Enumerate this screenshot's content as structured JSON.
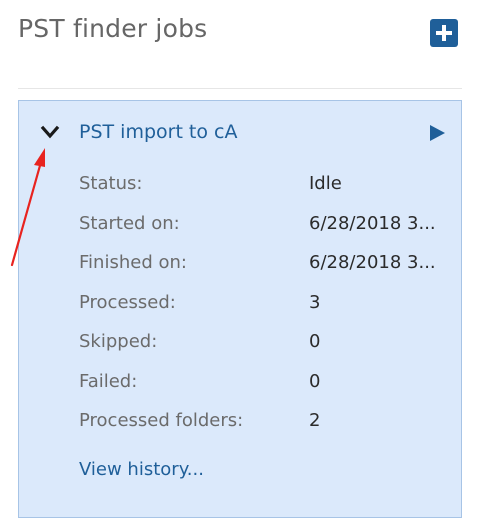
{
  "panel": {
    "title": "PST finder jobs",
    "add_icon": "plus-square-icon"
  },
  "job": {
    "title": "PST import to cA",
    "expand_icon": "chevron-down-icon",
    "run_icon": "play-icon",
    "details": [
      {
        "label": "Status:",
        "value": "Idle"
      },
      {
        "label": "Started on:",
        "value": "6/28/2018 3..."
      },
      {
        "label": "Finished on:",
        "value": "6/28/2018 3..."
      },
      {
        "label": "Processed:",
        "value": "3"
      },
      {
        "label": "Skipped:",
        "value": "0"
      },
      {
        "label": "Failed:",
        "value": "0"
      },
      {
        "label": "Processed folders:",
        "value": "2"
      }
    ],
    "history_link": "View history..."
  },
  "colors": {
    "accent": "#1f5f99",
    "card_bg": "#dbe9fb",
    "card_border": "#a7c4e6",
    "annotation": "#e8231f"
  }
}
